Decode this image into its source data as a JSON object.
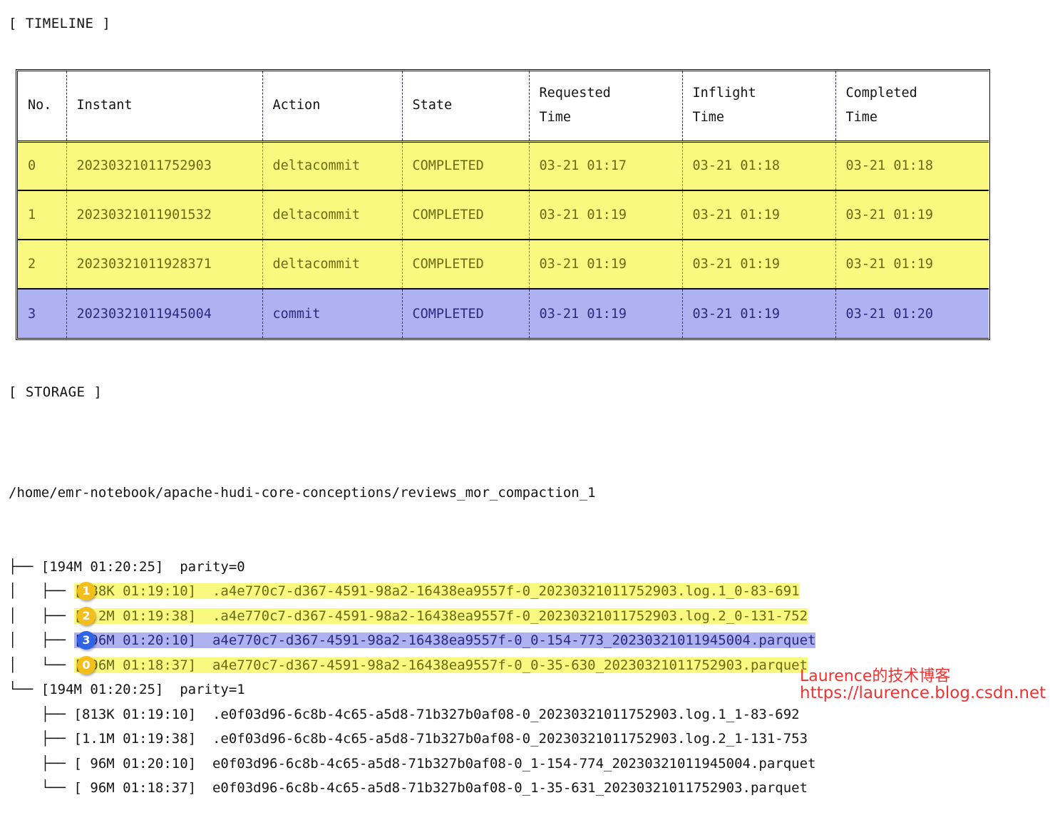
{
  "sections": {
    "timeline_caption": "[ TIMELINE ]",
    "storage_caption": "[ STORAGE ]"
  },
  "timeline_table": {
    "columns": [
      {
        "key": "no",
        "label": "No."
      },
      {
        "key": "instant",
        "label": "Instant"
      },
      {
        "key": "action",
        "label": "Action"
      },
      {
        "key": "state",
        "label": "State"
      },
      {
        "key": "requested",
        "label": "Requested\nTime"
      },
      {
        "key": "inflight",
        "label": "Inflight\nTime"
      },
      {
        "key": "completed",
        "label": "Completed\nTime"
      }
    ],
    "header_labels": {
      "no": "No.",
      "instant": "Instant",
      "action": "Action",
      "state": "State",
      "requested_line1": "Requested",
      "requested_line2": "Time",
      "inflight_line1": "Inflight",
      "inflight_line2": "Time",
      "completed_line1": "Completed",
      "completed_line2": "Time"
    },
    "rows": [
      {
        "no": "0",
        "instant": "20230321011752903",
        "action": "deltacommit",
        "state": "COMPLETED",
        "requested": "03-21 01:17",
        "inflight": "03-21 01:18",
        "completed": "03-21 01:18",
        "highlight": "yellow"
      },
      {
        "no": "1",
        "instant": "20230321011901532",
        "action": "deltacommit",
        "state": "COMPLETED",
        "requested": "03-21 01:19",
        "inflight": "03-21 01:19",
        "completed": "03-21 01:19",
        "highlight": "yellow"
      },
      {
        "no": "2",
        "instant": "20230321011928371",
        "action": "deltacommit",
        "state": "COMPLETED",
        "requested": "03-21 01:19",
        "inflight": "03-21 01:19",
        "completed": "03-21 01:19",
        "highlight": "yellow"
      },
      {
        "no": "3",
        "instant": "20230321011945004",
        "action": "commit",
        "state": "COMPLETED",
        "requested": "03-21 01:19",
        "inflight": "03-21 01:19",
        "completed": "03-21 01:20",
        "highlight": "blue"
      }
    ]
  },
  "storage_tree": {
    "root_path": "/home/emr-notebook/apache-hudi-core-conceptions/reviews_mor_compaction_1",
    "lines": [
      {
        "prefix": "├── ",
        "text": "[194M 01:20:25]  parity=0",
        "highlight": "none",
        "badge": null
      },
      {
        "prefix": "│   ├── ",
        "text": "[788K 01:19:10]  .a4e770c7-d367-4591-98a2-16438ea9557f-0_20230321011752903.log.1_0-83-691",
        "highlight": "yellow",
        "badge": "1",
        "badge_color": "gold"
      },
      {
        "prefix": "│   ├── ",
        "text": "[1.2M 01:19:38]  .a4e770c7-d367-4591-98a2-16438ea9557f-0_20230321011752903.log.2_0-131-752",
        "highlight": "yellow",
        "badge": "2",
        "badge_color": "gold"
      },
      {
        "prefix": "│   ├── ",
        "text": "[ 96M 01:20:10]  a4e770c7-d367-4591-98a2-16438ea9557f-0_0-154-773_20230321011945004.parquet",
        "highlight": "blue",
        "badge": "3",
        "badge_color": "blue"
      },
      {
        "prefix": "│   └── ",
        "text": "[ 96M 01:18:37]  a4e770c7-d367-4591-98a2-16438ea9557f-0_0-35-630_20230321011752903.parquet",
        "highlight": "yellow",
        "badge": "0",
        "badge_color": "gold"
      },
      {
        "prefix": "└── ",
        "text": "[194M 01:20:25]  parity=1",
        "highlight": "none",
        "badge": null
      },
      {
        "prefix": "    ├── ",
        "text": "[813K 01:19:10]  .e0f03d96-6c8b-4c65-a5d8-71b327b0af08-0_20230321011752903.log.1_1-83-692",
        "highlight": "none",
        "badge": null
      },
      {
        "prefix": "    ├── ",
        "text": "[1.1M 01:19:38]  .e0f03d96-6c8b-4c65-a5d8-71b327b0af08-0_20230321011752903.log.2_1-131-753",
        "highlight": "none",
        "badge": null
      },
      {
        "prefix": "    ├── ",
        "text": "[ 96M 01:20:10]  e0f03d96-6c8b-4c65-a5d8-71b327b0af08-0_1-154-774_20230321011945004.parquet",
        "highlight": "none",
        "badge": null
      },
      {
        "prefix": "    └── ",
        "text": "[ 96M 01:18:37]  e0f03d96-6c8b-4c65-a5d8-71b327b0af08-0_1-35-631_20230321011752903.parquet",
        "highlight": "none",
        "badge": null
      }
    ]
  },
  "watermark": {
    "line1": "Laurence的技术博客",
    "line2": "https://laurence.blog.csdn.net"
  },
  "colors": {
    "highlight_yellow_bg": "#f9f97f",
    "highlight_yellow_fg": "#6b6b14",
    "highlight_blue_bg": "#aeb2f0",
    "highlight_blue_fg": "#2a2a7e",
    "badge_gold": "#f5bf1b",
    "badge_blue": "#2f63e8",
    "watermark_red": "#ee2222",
    "text": "#141414"
  }
}
